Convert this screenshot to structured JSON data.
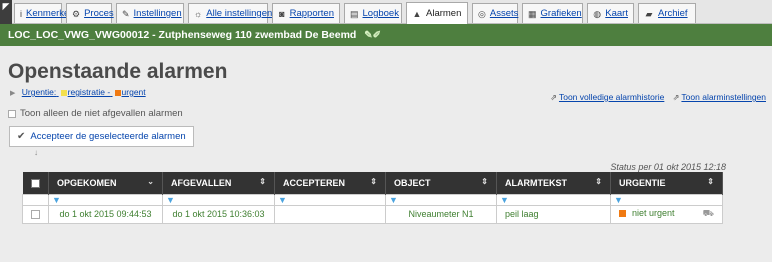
{
  "tabs": [
    {
      "icon": "info-icon",
      "glyph": "i",
      "label": "Kenmerken",
      "active": false
    },
    {
      "icon": "process-icon",
      "glyph": "⚙",
      "label": "Proces",
      "active": false
    },
    {
      "icon": "wrench-icon",
      "glyph": "✎",
      "label": "Instellingen",
      "active": false
    },
    {
      "icon": "settings-icon",
      "glyph": "☼",
      "label": "Alle instellingen",
      "active": false
    },
    {
      "icon": "report-icon",
      "glyph": "◙",
      "label": "Rapporten",
      "active": false
    },
    {
      "icon": "logbook-icon",
      "glyph": "▤",
      "label": "Logboek",
      "active": false
    },
    {
      "icon": "alarm-icon",
      "glyph": "▲",
      "label": "Alarmen",
      "active": true
    },
    {
      "icon": "assets-icon",
      "glyph": "◎",
      "label": "Assets",
      "active": false
    },
    {
      "icon": "chart-icon",
      "glyph": "▦",
      "label": "Grafieken",
      "active": false
    },
    {
      "icon": "globe-icon",
      "glyph": "◍",
      "label": "Kaart",
      "active": false
    },
    {
      "icon": "archive-icon",
      "glyph": "▰",
      "label": "Archief",
      "active": false
    }
  ],
  "location": {
    "title": "LOC_LOC_VWG_VWG00012 - Zutphenseweg 110 zwembad De Beemd",
    "edit_icon": "edit-pencil-icon"
  },
  "page_title": "Openstaande alarmen",
  "legend": {
    "urgency_label": "Urgentie:",
    "registration_label": "registratie -",
    "urgent_label": "urgent",
    "registration_color": "#f4e04d",
    "urgent_color": "#f07a12"
  },
  "links": {
    "history": "Toon volledige alarmhistorie",
    "settings": "Toon alarminstellingen"
  },
  "filter_checkbox_label": "Toon alleen de niet afgevallen alarmen",
  "accept_button": "Accepteer de geselecteerde alarmen",
  "accept_hint": "↓",
  "status": "Status per 01 okt 2015 12:18",
  "table": {
    "headers": [
      "OPGEKOMEN",
      "AFGEVALLEN",
      "ACCEPTEREN",
      "OBJECT",
      "ALARMTEKST",
      "URGENTIE"
    ],
    "rows": [
      {
        "opgekomen": "do 1 okt 2015 09:44:53",
        "afgevallen": "do 1 okt 2015 10:36:03",
        "accepteren": "",
        "object": "Niveaumeter N1",
        "alarmtekst": "peil laag",
        "urgentie": "niet urgent",
        "urgentie_color": "#f07a12"
      }
    ]
  }
}
